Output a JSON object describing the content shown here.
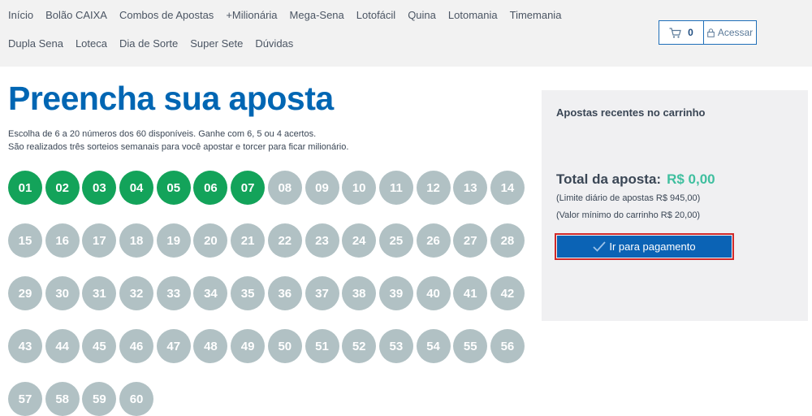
{
  "nav": {
    "row1": [
      "Início",
      "Bolão CAIXA",
      "Combos de Apostas",
      "+Milionária",
      "Mega-Sena",
      "Lotofácil",
      "Quina",
      "Lotomania",
      "Timemania"
    ],
    "row2": [
      "Dupla Sena",
      "Loteca",
      "Dia de Sorte",
      "Super Sete",
      "Dúvidas"
    ]
  },
  "cart": {
    "count": "0",
    "icon": "cart-icon"
  },
  "login": {
    "label": "Acessar",
    "icon": "lock-icon"
  },
  "page": {
    "title": "Preencha sua aposta",
    "description_1": "Escolha de 6 a 20 números dos 60 disponíveis. Ganhe com 6, 5 ou 4 acertos.",
    "description_2": "São realizados três sorteios semanais para você apostar e torcer para ficar milionário."
  },
  "numbers": [
    "01",
    "02",
    "03",
    "04",
    "05",
    "06",
    "07",
    "08",
    "09",
    "10",
    "11",
    "12",
    "13",
    "14",
    "15",
    "16",
    "17",
    "18",
    "19",
    "20",
    "21",
    "22",
    "23",
    "24",
    "25",
    "26",
    "27",
    "28",
    "29",
    "30",
    "31",
    "32",
    "33",
    "34",
    "35",
    "36",
    "37",
    "38",
    "39",
    "40",
    "41",
    "42",
    "43",
    "44",
    "45",
    "46",
    "47",
    "48",
    "49",
    "50",
    "51",
    "52",
    "53",
    "54",
    "55",
    "56",
    "57",
    "58",
    "59",
    "60"
  ],
  "selected": [
    "01",
    "02",
    "03",
    "04",
    "05",
    "06",
    "07"
  ],
  "colors": {
    "selected": "#13a35a",
    "unselected": "#b1c1c4",
    "brand": "#0066b3",
    "accent_value": "#3fbf9f"
  },
  "sidebar": {
    "recent_title": "Apostas recentes no carrinho",
    "total_label": "Total da aposta:",
    "total_value": "R$ 0,00",
    "limit_1": "(Limite diário de apostas R$ 945,00)",
    "limit_2": "(Valor mínimo do carrinho R$ 20,00)",
    "pay_label": "Ir para pagamento",
    "pay_icon": "check-icon"
  }
}
